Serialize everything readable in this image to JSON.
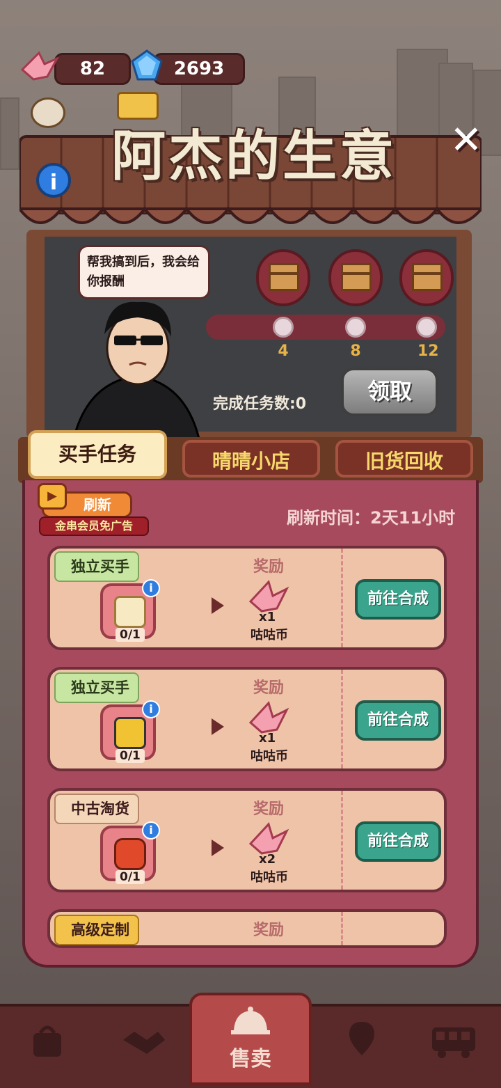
{
  "currency": {
    "cranes": "82",
    "gems": "2693"
  },
  "title": "阿杰的生意",
  "speech": "帮我搞到后，我会给你报酬",
  "milestones": [
    "4",
    "8",
    "12"
  ],
  "completed_text": "完成任务数:0",
  "claim_label": "领取",
  "tabs": [
    "买手任务",
    "晴晴小店",
    "旧货回收"
  ],
  "refresh": {
    "label": "刷新",
    "vip": "金串会员免广告",
    "time": "刷新时间：2天11小时"
  },
  "tasks": [
    {
      "tag": "独立买手",
      "count": "0/1",
      "reward_label": "奖励",
      "mult": "x1",
      "currency": "咕咕币",
      "button": "前往合成"
    },
    {
      "tag": "独立买手",
      "count": "0/1",
      "reward_label": "奖励",
      "mult": "x1",
      "currency": "咕咕币",
      "button": "前往合成"
    },
    {
      "tag": "中古淘货",
      "count": "0/1",
      "reward_label": "奖励",
      "mult": "x2",
      "currency": "咕咕币",
      "button": "前往合成"
    },
    {
      "tag": "高级定制",
      "count": "",
      "reward_label": "奖励",
      "mult": "",
      "currency": "",
      "button": ""
    }
  ],
  "nav": {
    "sell": "售卖"
  },
  "colors": {
    "accent": "#3aa58c",
    "panel": "#a84a5e",
    "board": "#3f4043"
  }
}
